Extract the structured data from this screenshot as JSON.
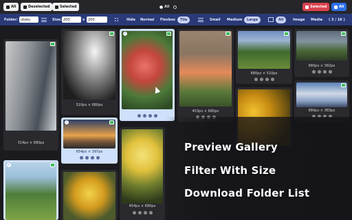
{
  "toolbar": {
    "all_label": "All",
    "deselected_label": "Deselected",
    "selected_label": "Selected",
    "radio_all": "All",
    "radio_none": "",
    "right_selected": "Selected",
    "right_all": "All"
  },
  "filters": {
    "folder_label": "Folder:",
    "folder_value": "utaku",
    "size_label": "Size:",
    "width_value": "200",
    "x_label": "x",
    "height_value": "200",
    "views": [
      "Hide",
      "Normal",
      "Flexbox",
      "Tile"
    ],
    "active_view": "Tile",
    "sizes": [
      "Small",
      "Medium",
      "Large"
    ],
    "active_size": "Large",
    "types": [
      "All",
      "Image",
      "Media"
    ],
    "active_type": "All",
    "count": "( 3 / 16 )"
  },
  "cards": [
    {
      "caption": "314px × 680px"
    },
    {
      "caption": "510px × 680px"
    },
    {
      "caption": ""
    },
    {
      "caption": "453px × 680px"
    },
    {
      "caption": "680px × 510px"
    },
    {
      "caption": "680px × 382px"
    },
    {
      "caption": "680px × 383px"
    },
    {
      "caption": "654px × 397px"
    },
    {
      "caption": "454px × 680px"
    },
    {
      "caption": ""
    },
    {
      "caption": ""
    },
    {
      "caption": ""
    }
  ],
  "promo": {
    "line1": "Preview Gallery",
    "line2": "Filter With Size",
    "line3": "Download Folder List"
  },
  "colors": {
    "accent_blue": "#2d6fe8",
    "filter_bar": "#2a3a78",
    "danger": "#d9434e"
  }
}
